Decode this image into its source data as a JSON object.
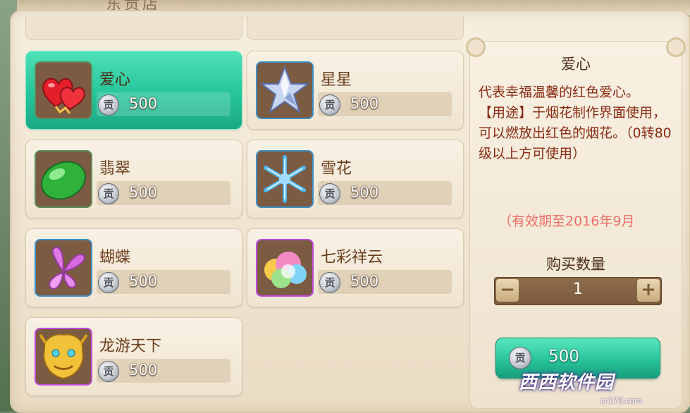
{
  "header": {
    "title_fragment": "东贡店"
  },
  "items": [
    {
      "name": "爱心",
      "price": "500",
      "icon": "heart-icon",
      "selected": true
    },
    {
      "name": "星星",
      "price": "500",
      "icon": "star-icon",
      "selected": false
    },
    {
      "name": "翡翠",
      "price": "500",
      "icon": "jade-icon",
      "selected": false
    },
    {
      "name": "雪花",
      "price": "500",
      "icon": "snowflake-icon",
      "selected": false
    },
    {
      "name": "蝴蝶",
      "price": "500",
      "icon": "butterfly-icon",
      "selected": false
    },
    {
      "name": "七彩祥云",
      "price": "500",
      "icon": "rainbow-cloud-icon",
      "selected": false
    },
    {
      "name": "龙游天下",
      "price": "500",
      "icon": "golden-dragon-icon",
      "selected": false
    }
  ],
  "currency_glyph": "贡",
  "detail": {
    "title": "爱心",
    "description": "代表幸福温馨的红色爱心。\n【用途】于烟花制作界面使用，可以燃放出红色的烟花。（0转80级以上方可使用）",
    "expiry": "（有效期至2016年9月",
    "quantity_label": "购买数量",
    "quantity_value": "1",
    "minus_label": "−",
    "plus_label": "+",
    "buy_price": "500"
  },
  "watermark": {
    "text": "西西软件园",
    "sub": "cr173.com"
  },
  "colors": {
    "selected_card": "#26c59b",
    "buy_button": "#28c49b",
    "description_text": "#8a2a12",
    "expiry_text": "#ee6f6a"
  }
}
